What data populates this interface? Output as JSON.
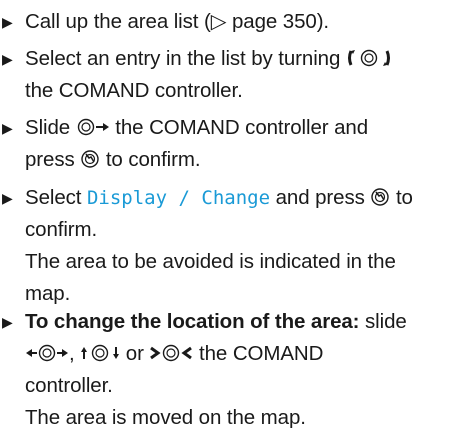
{
  "steps": [
    {
      "line1_a": "Call up the area list (",
      "page_ref_arrow": "▷",
      "line1_b": " page 350)."
    },
    {
      "line1_a": "Select an entry in the list by turning ",
      "line2": "the COMAND controller."
    },
    {
      "line1_a": "Slide ",
      "line1_b": " the COMAND controller and",
      "line2_a": "press ",
      "line2_b": " to confirm."
    },
    {
      "line1_a": "Select ",
      "line1_menu": "Display / Change",
      "line1_b": " and press ",
      "line1_c": " to",
      "line2": "confirm.",
      "line3": "The area to be avoided is indicated in the",
      "line4": "map."
    },
    {
      "line1_bold": "To change the location of the area:",
      "line1_b": " slide",
      "line2_a": ", ",
      "line2_b": " or ",
      "line2_c": " the COMAND",
      "line3": "controller.",
      "line4": "The area is moved on the map."
    }
  ],
  "icons": {
    "bullet": "triangle-bullet-icon",
    "turn": "controller-turn-icon",
    "slide_right": "controller-slide-right-icon",
    "slide_left_right": "controller-slide-left-right-icon",
    "slide_up_down": "controller-slide-up-down-icon",
    "slide_diagonal": "controller-slide-diagonal-icon",
    "press": "controller-press-icon"
  },
  "colors": {
    "text": "#1a1a1a",
    "menu_item": "#1a9ad6"
  }
}
